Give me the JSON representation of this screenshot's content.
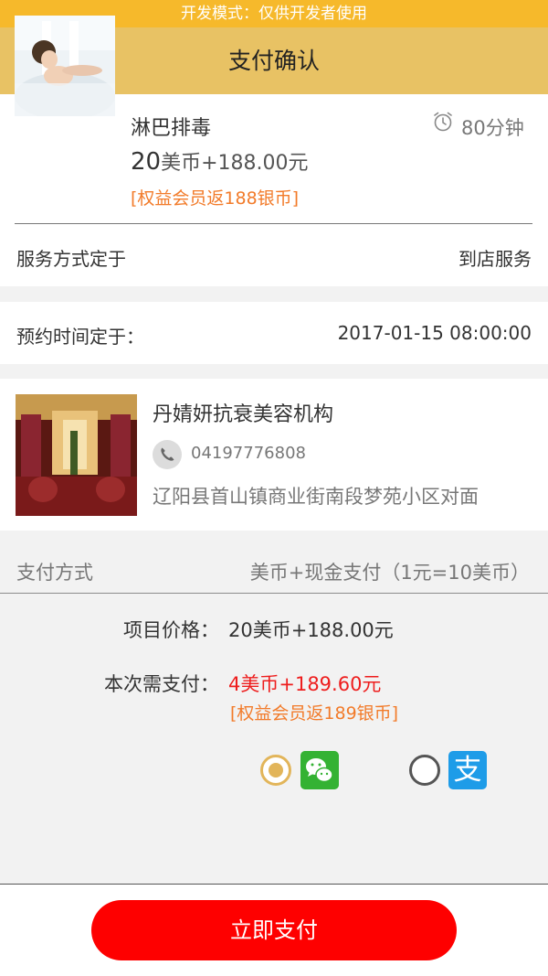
{
  "dev_banner": "开发模式：仅供开发者使用",
  "nav": {
    "title": "支付确认"
  },
  "service": {
    "name": "淋巴排毒",
    "price_main": "20",
    "price_rest": "美币+188.00元",
    "rebate": "[权益会员返188银币]",
    "duration": "80分钟"
  },
  "service_method": {
    "label": "服务方式定于",
    "value": "到店服务"
  },
  "appointment": {
    "label": "预约时间定于：",
    "value": "2017-01-15 08:00:00"
  },
  "shop": {
    "name": "丹婧妍抗衰美容机构",
    "phone": "04197776808",
    "address": "辽阳县首山镇商业街南段梦苑小区对面"
  },
  "payment": {
    "label": "支付方式",
    "value": "美币+现金支付（1元=10美币）",
    "item_price_label": "项目价格：",
    "item_price_value": "20美币+188.00元",
    "due_label": "本次需支付：",
    "due_value": "4美币+189.60元",
    "due_rebate": "[权益会员返189银币]",
    "alipay_glyph": "支",
    "selected_method": "wechat"
  },
  "pay_button": "立即支付",
  "colors": {
    "dev_bar": "#f6b92b",
    "nav_bar": "#e8c264",
    "accent_orange": "#f27b2a",
    "price_red": "#ee1d1d",
    "pay_button": "#fe0000",
    "radio_selected": "#e2b55a",
    "wechat_green": "#34b233",
    "alipay_blue": "#1e9ce8"
  }
}
